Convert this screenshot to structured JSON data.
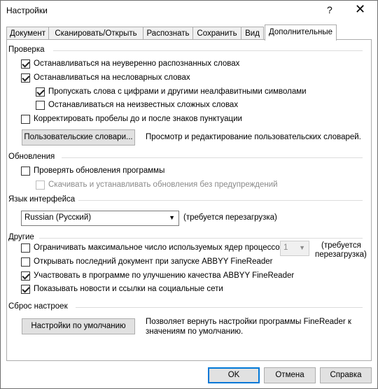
{
  "window": {
    "title": "Настройки",
    "help_glyph": "?",
    "close_glyph": "✕"
  },
  "tabs": [
    {
      "label": "Документ"
    },
    {
      "label": "Сканировать/Открыть"
    },
    {
      "label": "Распознать"
    },
    {
      "label": "Сохранить"
    },
    {
      "label": "Вид"
    },
    {
      "label": "Дополнительные"
    }
  ],
  "sections": {
    "check": {
      "title": "Проверка",
      "stop_uncertain": {
        "label": "Останавливаться на неуверенно распознанных словах",
        "checked": true
      },
      "stop_nondictionary": {
        "label": "Останавливаться на несловарных словах",
        "checked": true
      },
      "skip_digits": {
        "label": "Пропускать слова с цифрами и другими неалфавитными символами",
        "checked": true
      },
      "stop_compound": {
        "label": "Останавливаться на неизвестных сложных словах",
        "checked": false
      },
      "correct_spaces": {
        "label": "Корректировать пробелы до и после знаков пунктуации",
        "checked": false
      },
      "user_dicts_button": "Пользовательские словари...",
      "user_dicts_desc": "Просмотр и редактирование пользовательских словарей."
    },
    "updates": {
      "title": "Обновления",
      "check_updates": {
        "label": "Проверять обновления программы",
        "checked": false
      },
      "auto_install": {
        "label": "Скачивать и устанавливать обновления без предупреждений",
        "checked": false
      }
    },
    "language": {
      "title": "Язык интерфейса",
      "selected": "Russian (Русский)",
      "restart_note": "(требуется перезагрузка)"
    },
    "other": {
      "title": "Другие",
      "limit_cores": {
        "label": "Ограничивать максимальное число используемых ядер процессора",
        "checked": false
      },
      "cores_value": "1",
      "restart_note_line1": "(требуется",
      "restart_note_line2": "перезагрузка)",
      "open_last": {
        "label": "Открывать последний документ при запуске ABBYY FineReader",
        "checked": false
      },
      "quality_program": {
        "label": "Участвовать в программе по улучшению качества ABBYY FineReader",
        "checked": true
      },
      "show_news": {
        "label": "Показывать новости и ссылки на социальные сети",
        "checked": true
      }
    },
    "reset": {
      "title": "Сброс настроек",
      "defaults_button": "Настройки по умолчанию",
      "desc_line1": "Позволяет вернуть настройки программы FineReader к",
      "desc_line2": "значениям по умолчанию."
    }
  },
  "footer": {
    "ok": "OK",
    "cancel": "Отмена",
    "help": "Справка"
  },
  "colors": {
    "accent": "#0078d7",
    "button_face": "#e1e1e1",
    "tab_inactive": "#f0f0f0",
    "group_line": "#dcdcdc"
  }
}
